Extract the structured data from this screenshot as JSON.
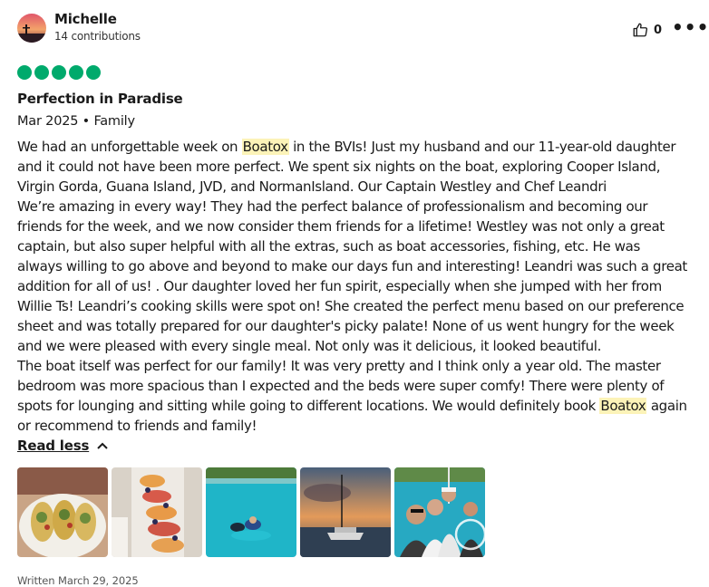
{
  "reviewer": {
    "name": "Michelle",
    "contributions": "14 contributions",
    "avatar_icon": "sunset-avatar-icon"
  },
  "actions": {
    "helpful_count": "0",
    "helpful_icon": "thumbs-up-icon",
    "more_label": "•••"
  },
  "rating": {
    "value": 5,
    "max": 5,
    "color": "#00aa6c"
  },
  "review": {
    "title": "Perfection in Paradise",
    "meta": "Mar 2025 • Family",
    "highlight_color": "#fcf3b8",
    "lines": [
      {
        "pre": "We had an unforgettable week on ",
        "mark": "Boatox",
        "post": " in the BVIs! Just my husband and our 11-year-old daughter"
      },
      {
        "pre": "and it could not have been more perfect. We spent six nights on the boat, exploring Cooper Island,",
        "mark": "",
        "post": ""
      },
      {
        "pre": "Virgin Gorda, Guana Island, JVD, and NormanIsland. Our Captain Westley and Chef Leandri",
        "mark": "",
        "post": ""
      },
      {
        "pre": "We’re amazing in every way! They had the perfect balance of professionalism and becoming our",
        "mark": "",
        "post": ""
      },
      {
        "pre": "friends for the week, and we now consider them friends for a lifetime! Westley was not only a great",
        "mark": "",
        "post": ""
      },
      {
        "pre": "captain, but also super helpful with all the extras, such as boat accessories, fishing, etc. He was",
        "mark": "",
        "post": ""
      },
      {
        "pre": "always willing to go above and beyond to make our days fun and interesting! Leandri was such a great",
        "mark": "",
        "post": ""
      },
      {
        "pre": "addition for all of us! . Our daughter loved her fun spirit, especially when she jumped with her from",
        "mark": "",
        "post": ""
      },
      {
        "pre": "Willie Ts! Leandri’s cooking skills were spot on! She created the perfect menu based on our preference",
        "mark": "",
        "post": ""
      },
      {
        "pre": "sheet and was totally prepared for our daughter's picky palate! None of us went hungry for the week",
        "mark": "",
        "post": ""
      },
      {
        "pre": "and we were pleased with every single meal. Not only was it delicious, it looked beautiful.",
        "mark": "",
        "post": ""
      },
      {
        "pre": "The boat itself was perfect for our family! It was very pretty and I think only a year old. The master",
        "mark": "",
        "post": ""
      },
      {
        "pre": "bedroom was more spacious than I expected and the beds were super comfy! There were plenty of",
        "mark": "",
        "post": ""
      },
      {
        "pre": "spots for lounging and sitting while going to different locations. We would definitely book ",
        "mark": "Boatox",
        "post": " again"
      },
      {
        "pre": "or recommend to friends and family!",
        "mark": "",
        "post": ""
      }
    ],
    "read_less": "Read less"
  },
  "photos": [
    {
      "subject": "tacos-photo"
    },
    {
      "subject": "fruit-platter-photo"
    },
    {
      "subject": "snorkeling-photo"
    },
    {
      "subject": "catamaran-sunset-photo"
    },
    {
      "subject": "family-on-boat-photo"
    }
  ],
  "footer": {
    "written": "Written March 29, 2025"
  }
}
